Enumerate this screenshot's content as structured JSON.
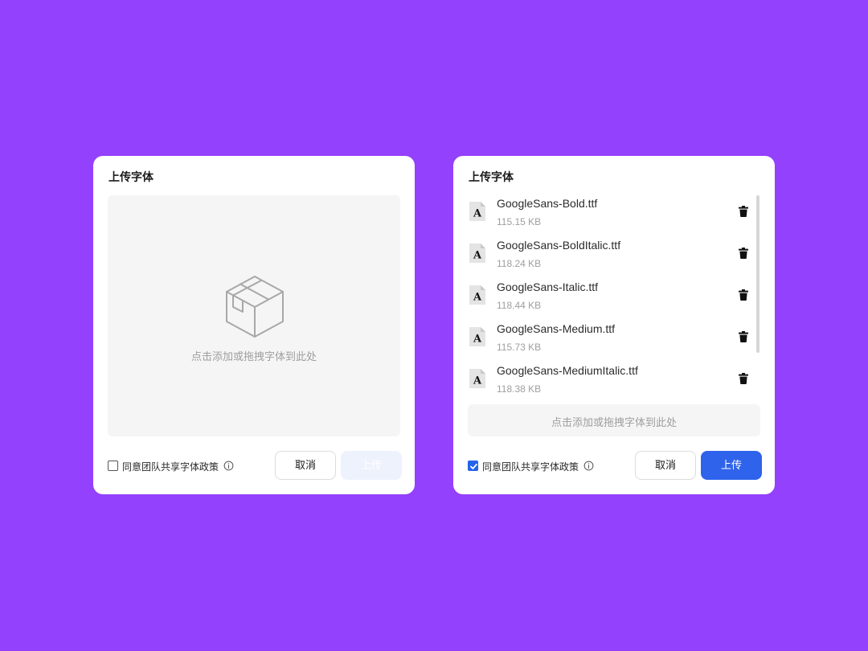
{
  "colors": {
    "background": "#9341FC",
    "primary": "#2F63EB",
    "primary_disabled": "#EEF2FD",
    "dropzone": "#F5F5F5"
  },
  "dialogs": {
    "empty": {
      "title": "上传字体",
      "drop_hint": "点击添加或拖拽字体到此处",
      "drop_icon": "box-icon",
      "agree_label": "同意团队共享字体政策",
      "agree_checked": false,
      "cancel_label": "取消",
      "upload_label": "上传",
      "upload_enabled": false
    },
    "filled": {
      "title": "上传字体",
      "files": [
        {
          "name": "GoogleSans-Bold.ttf",
          "size": "115.15 KB"
        },
        {
          "name": "GoogleSans-BoldItalic.ttf",
          "size": "118.24 KB"
        },
        {
          "name": "GoogleSans-Italic.ttf",
          "size": "118.44 KB"
        },
        {
          "name": "GoogleSans-Medium.ttf",
          "size": "115.73 KB"
        },
        {
          "name": "GoogleSans-MediumItalic.ttf",
          "size": "118.38 KB"
        }
      ],
      "file_icon": "font-file-icon",
      "file_icon_letter": "A",
      "delete_icon": "trash-icon",
      "drop_hint": "点击添加或拖拽字体到此处",
      "agree_label": "同意团队共享字体政策",
      "agree_checked": true,
      "cancel_label": "取消",
      "upload_label": "上传",
      "upload_enabled": true
    }
  }
}
